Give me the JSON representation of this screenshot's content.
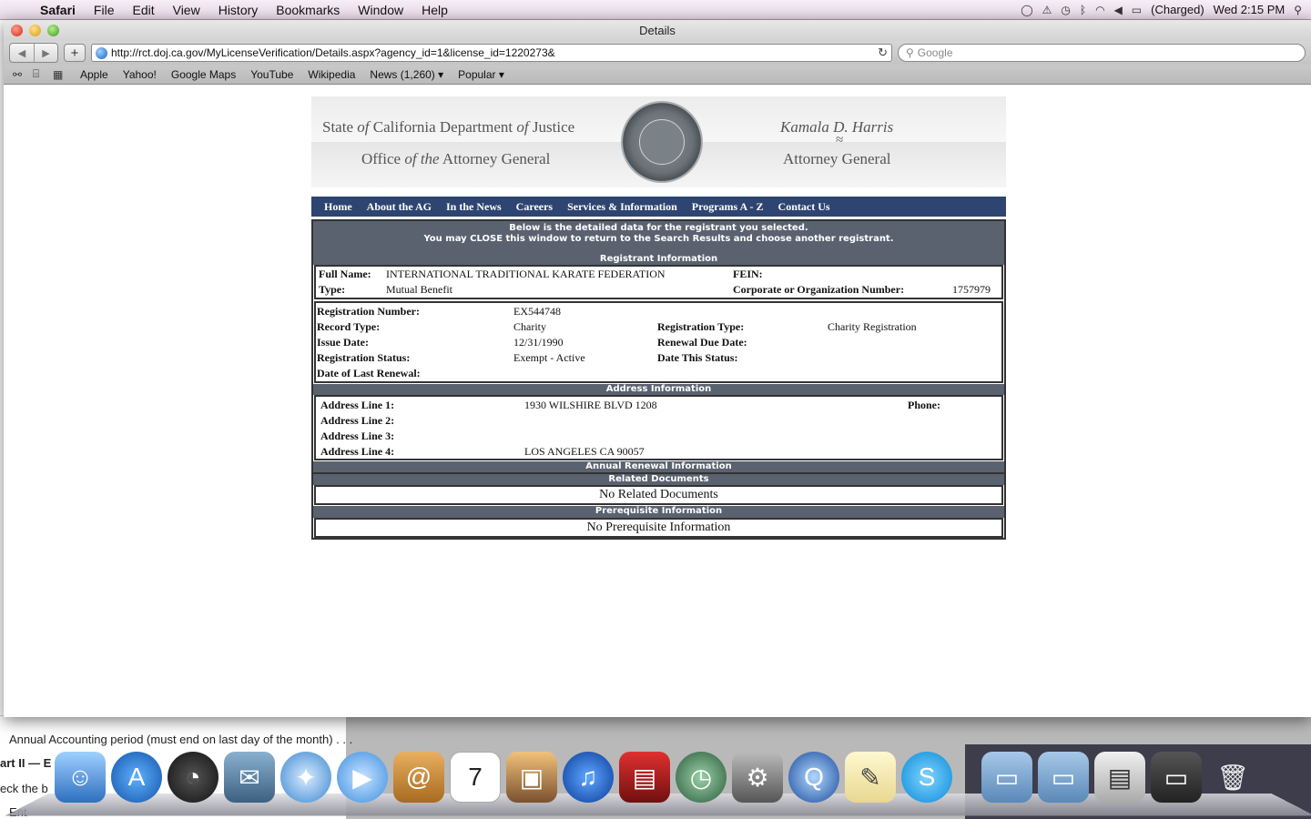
{
  "menubar": {
    "app": "Safari",
    "items": [
      "File",
      "Edit",
      "View",
      "History",
      "Bookmarks",
      "Window",
      "Help"
    ],
    "battery": "(Charged)",
    "clock": "Wed 2:15 PM"
  },
  "window": {
    "title": "Details",
    "url": "http://rct.doj.ca.gov/MyLicenseVerification/Details.aspx?agency_id=1&license_id=1220273&",
    "search_placeholder": "Google",
    "bookmarks": [
      "Apple",
      "Yahoo!",
      "Google Maps",
      "YouTube",
      "Wikipedia",
      "News (1,260) ▾",
      "Popular ▾"
    ]
  },
  "header": {
    "dept_line1_a": "State ",
    "dept_line1_b": "of",
    "dept_line1_c": " California Department ",
    "dept_line1_d": "of",
    "dept_line1_e": " Justice",
    "dept_line2_a": "Office ",
    "dept_line2_b": "of the",
    "dept_line2_c": " Attorney General",
    "ag_name": "Kamala D. Harris",
    "ag_tilde": "≈",
    "ag_title": "Attorney General"
  },
  "nav": [
    "Home",
    "About the AG",
    "In the News",
    "Careers",
    "Services & Information",
    "Programs A - Z",
    "Contact Us"
  ],
  "detail": {
    "intro1": "Below is the detailed data for the registrant you selected.",
    "intro2": "You may CLOSE this window to return to the Search Results and choose another registrant.",
    "registrant_header": "Registrant Information",
    "full_name_label": "Full Name:",
    "full_name": "INTERNATIONAL TRADITIONAL KARATE FEDERATION",
    "fein_label": "FEIN:",
    "type_label": "Type:",
    "type": "Mutual Benefit",
    "corp_label": "Corporate or Organization Number:",
    "corp_number": "1757979",
    "reg_number_label": "Registration Number:",
    "reg_number": "EX544748",
    "record_type_label": "Record Type:",
    "record_type": "Charity",
    "reg_type_label": "Registration Type:",
    "reg_type": "Charity Registration",
    "issue_date_label": "Issue Date:",
    "issue_date": "12/31/1990",
    "renewal_due_label": "Renewal Due Date:",
    "reg_status_label": "Registration Status:",
    "reg_status": "Exempt - Active",
    "date_status_label": "Date This Status:",
    "last_renewal_label": "Date of Last Renewal:",
    "address_header": "Address Information",
    "addr1_label": "Address Line 1:",
    "addr1": "1930 WILSHIRE BLVD 1208",
    "phone_label": "Phone:",
    "addr2_label": "Address Line 2:",
    "addr3_label": "Address Line 3:",
    "addr4_label": "Address Line 4:",
    "addr4": "LOS ANGELES CA 90057",
    "annual_header": "Annual Renewal Information",
    "related_header": "Related Documents",
    "related_msg": "No Related Documents",
    "prereq_header": "Prerequisite Information",
    "prereq_msg": "No Prerequisite Information"
  },
  "background_window": {
    "line1": "Annual Accounting period (must end on last day of the month)  . . .",
    "line2": "art II — E",
    "line3": "eck the b",
    "line4": "Ent"
  }
}
